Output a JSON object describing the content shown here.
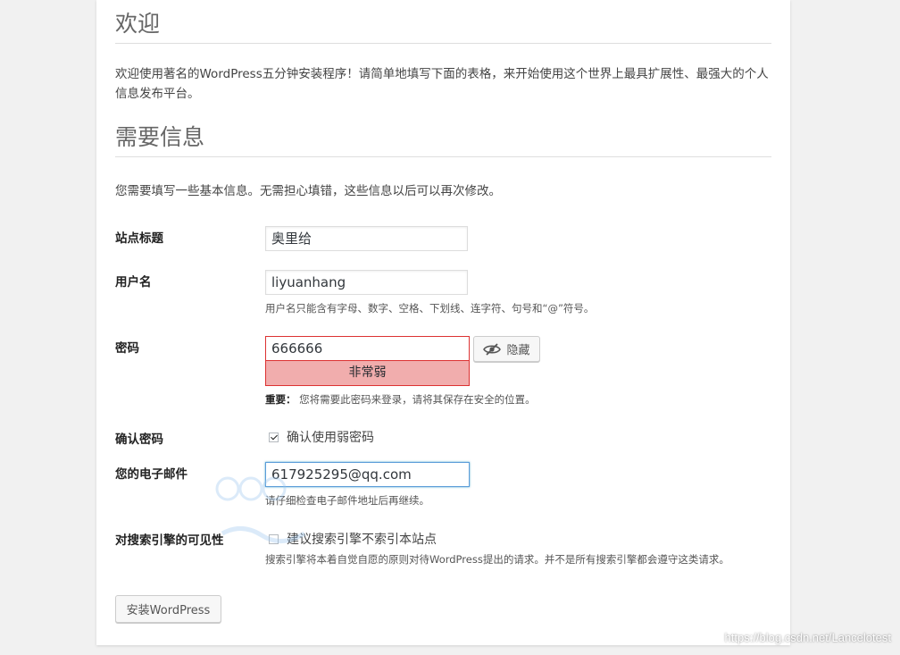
{
  "welcome": {
    "heading": "欢迎",
    "intro": "欢迎使用著名的WordPress五分钟安装程序！请简单地填写下面的表格，来开始使用这个世界上最具扩展性、最强大的个人信息发布平台。"
  },
  "info": {
    "heading": "需要信息",
    "intro": "您需要填写一些基本信息。无需担心填错，这些信息以后可以再次修改。"
  },
  "form": {
    "site_title": {
      "label": "站点标题",
      "value": "奥里给"
    },
    "username": {
      "label": "用户名",
      "value": "liyuanhang",
      "hint": "用户名只能含有字母、数字、空格、下划线、连字符、句号和“@”符号。"
    },
    "password": {
      "label": "密码",
      "value": "666666",
      "strength": "非常弱",
      "hide_label": "隐藏",
      "hint_strong": "重要：",
      "hint": "您将需要此密码来登录，请将其保存在安全的位置。"
    },
    "confirm": {
      "label": "确认密码",
      "checkbox_label": "确认使用弱密码",
      "checked": true
    },
    "email": {
      "label": "您的电子邮件",
      "value": "617925295@qq.com",
      "hint": "请仔细检查电子邮件地址后再继续。"
    },
    "visibility": {
      "label": "对搜索引擎的可见性",
      "checkbox_label": "建议搜索引擎不索引本站点",
      "checked": false,
      "hint": "搜索引擎将本着自觉自愿的原则对待WordPress提出的请求。并不是所有搜索引擎都会遵守这类请求。"
    },
    "install_button": "安装WordPress"
  },
  "watermark": "https://blog.csdn.net/Lancelotest",
  "colors": {
    "error_border": "#dc3232",
    "strength_bg": "#f1adad",
    "focus_border": "#5b9dd9"
  }
}
